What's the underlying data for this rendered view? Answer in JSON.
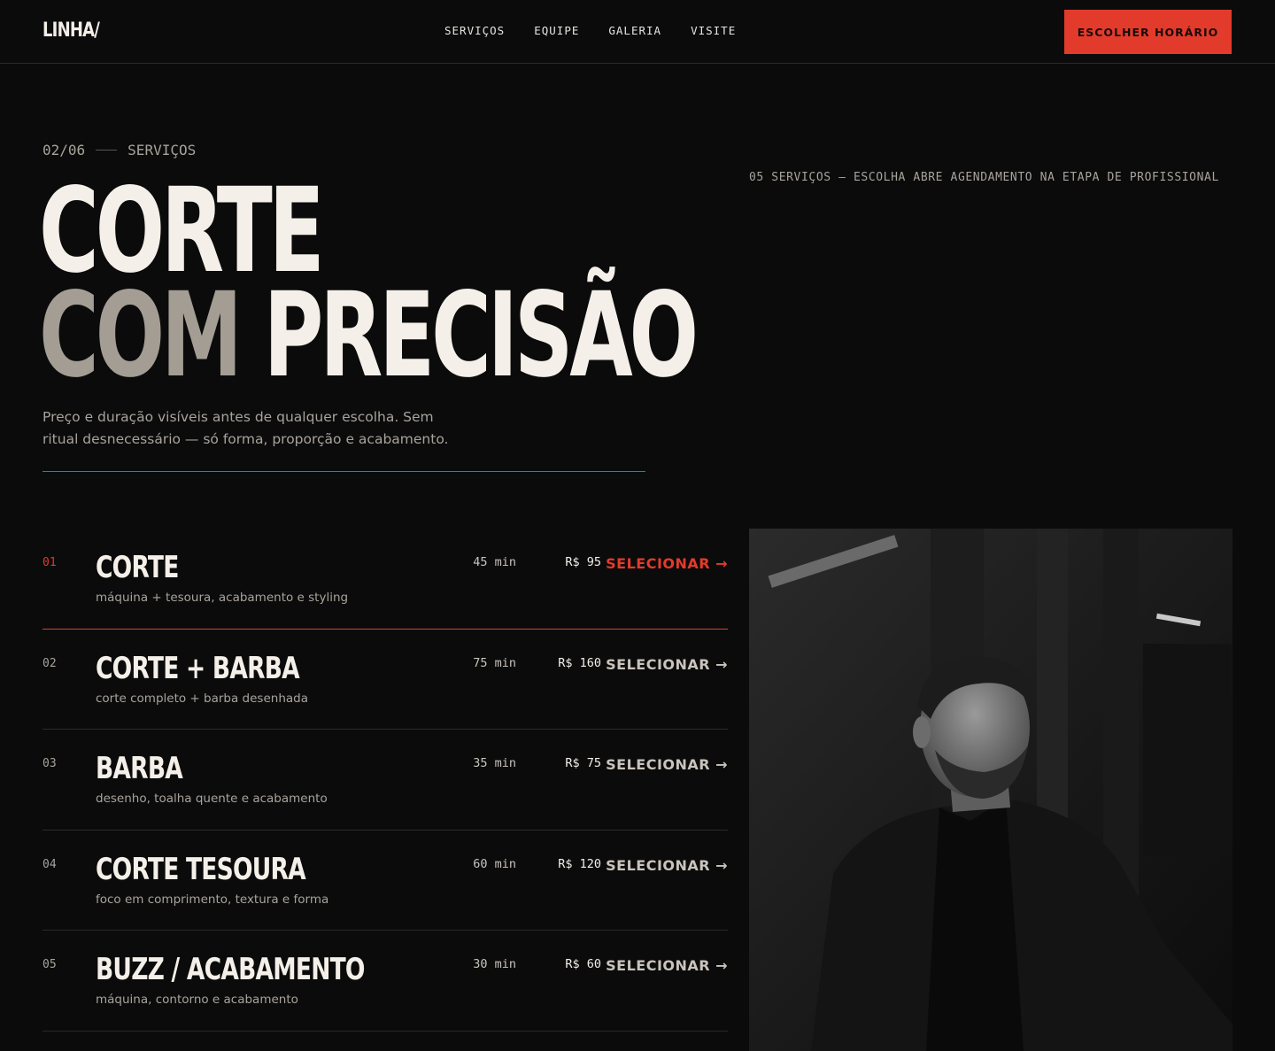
{
  "header": {
    "logo": "LINHA/",
    "nav": [
      "SERVIÇOS",
      "EQUIPE",
      "GALERIA",
      "VISITE"
    ],
    "cta": "ESCOLHER HORÁRIO"
  },
  "hero": {
    "step": "02/06",
    "section": "SERVIÇOS",
    "side_note": "05 SERVIÇOS — ESCOLHA ABRE AGENDAMENTO NA ETAPA DE PROFISSIONAL",
    "headline_line1": "CORTE",
    "headline_muted": "COM",
    "headline_line2_rest": "PRECISÃO",
    "subtitle": "Preço e duração visíveis antes de qualquer escolha. Sem ritual desnecessário — só forma, proporção e acabamento."
  },
  "services": [
    {
      "num": "01",
      "title": "CORTE",
      "desc": "máquina + tesoura, acabamento e styling",
      "duration": "45 min",
      "price": "R$ 95",
      "action": "SELECIONAR",
      "active": true
    },
    {
      "num": "02",
      "title": "CORTE + BARBA",
      "desc": "corte completo + barba desenhada",
      "duration": "75 min",
      "price": "R$ 160",
      "action": "SELECIONAR",
      "active": false
    },
    {
      "num": "03",
      "title": "BARBA",
      "desc": "desenho, toalha quente e acabamento",
      "duration": "35 min",
      "price": "R$ 75",
      "action": "SELECIONAR",
      "active": false
    },
    {
      "num": "04",
      "title": "CORTE TESOURA",
      "desc": "foco em comprimento, textura e forma",
      "duration": "60 min",
      "price": "R$ 120",
      "action": "SELECIONAR",
      "active": false
    },
    {
      "num": "05",
      "title": "BUZZ / ACABAMENTO",
      "desc": "máquina, contorno e acabamento",
      "duration": "30 min",
      "price": "R$ 60",
      "action": "SELECIONAR",
      "active": false
    }
  ],
  "colors": {
    "accent": "#e23b2c",
    "background": "#0b0b0c",
    "text": "#f2eee8",
    "muted": "#a8a39b"
  },
  "icons": {
    "arrow": "arrow-right-icon"
  }
}
